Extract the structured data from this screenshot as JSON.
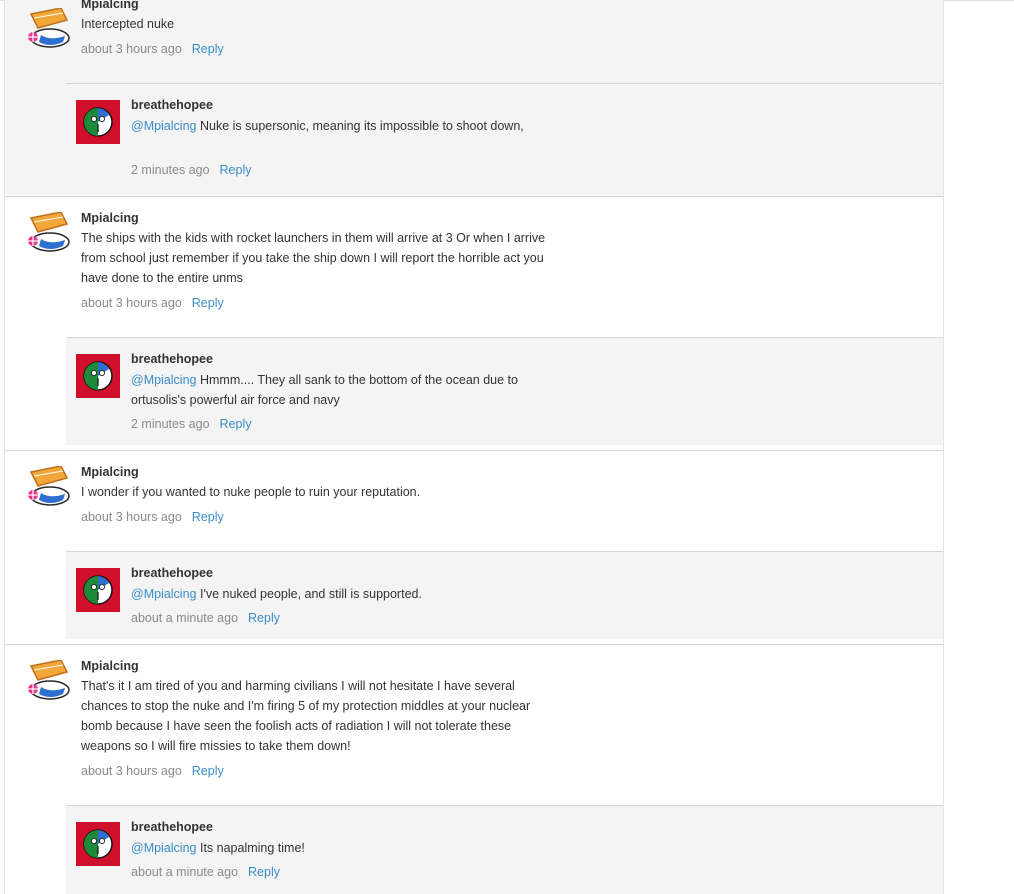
{
  "colors": {
    "link": "#3a8dc8",
    "reply_bg": "#f4f4f4",
    "meta": "#8a8a8a",
    "avatar_red": "#d0102a"
  },
  "threads": [
    {
      "comment": {
        "author": "Mpialcing",
        "text": "Intercepted nuke",
        "time": "about 3 hours ago",
        "reply_label": "Reply"
      },
      "reply": {
        "author": "breathehopee",
        "mention": "@Mpialcing",
        "text": " Nuke is supersonic, meaning its impossible to shoot down,",
        "time": "2 minutes ago",
        "reply_label": "Reply"
      }
    },
    {
      "comment": {
        "author": "Mpialcing",
        "text": "The ships with the kids with rocket launchers in them will arrive at 3 Or when I arrive from school just remember if you take the ship down I will report the horrible act you have done to the entire unms",
        "time": "about 3 hours ago",
        "reply_label": "Reply"
      },
      "reply": {
        "author": "breathehopee",
        "mention": "@Mpialcing",
        "text": " Hmmm.... They all sank to the bottom of the ocean due to ortusolis's powerful air force and navy",
        "time": "2 minutes ago",
        "reply_label": "Reply"
      }
    },
    {
      "comment": {
        "author": "Mpialcing",
        "text": "I wonder if you wanted to nuke people to ruin your reputation.",
        "time": "about 3 hours ago",
        "reply_label": "Reply"
      },
      "reply": {
        "author": "breathehopee",
        "mention": "@Mpialcing",
        "text": " I've nuked people, and still is supported.",
        "time": "about a minute ago",
        "reply_label": "Reply"
      }
    },
    {
      "comment": {
        "author": "Mpialcing",
        "text": "That's it I am tired of you and harming civilians I will not hesitate I have several chances to stop the nuke and I'm firing 5 of my protection middles at your nuclear bomb because I have seen the foolish acts of radiation I will not tolerate these weapons so I will fire missies to take them down!",
        "time": "about 3 hours ago",
        "reply_label": "Reply"
      },
      "reply": {
        "author": "breathehopee",
        "mention": "@Mpialcing",
        "text": " Its napalming time!",
        "time": "about a minute ago",
        "reply_label": "Reply"
      }
    }
  ]
}
